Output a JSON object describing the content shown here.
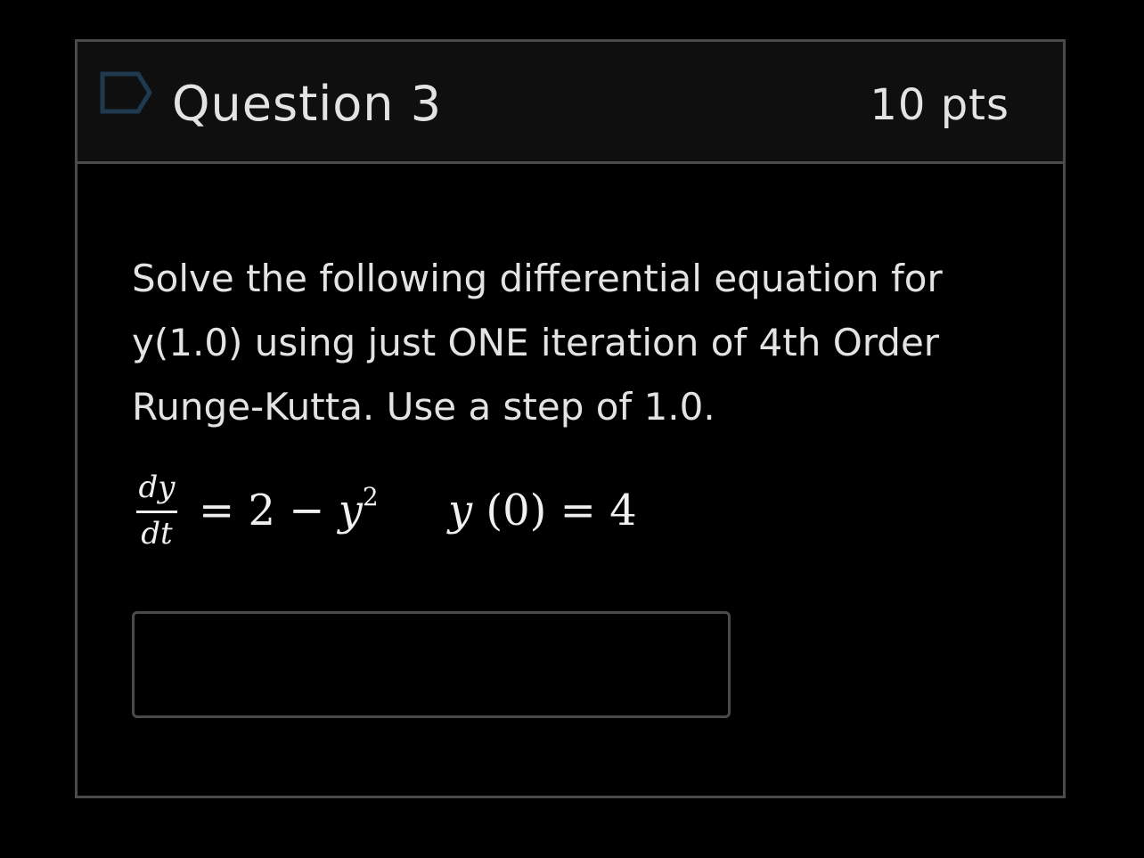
{
  "question": {
    "title": "Question 3",
    "points": "10 pts",
    "flag_icon": "flag-outline-icon",
    "text": "Solve the following differential equation for y(1.0) using just ONE iteration of 4th Order Runge-Kutta. Use a step of 1.0.",
    "equation": {
      "derivative_numerator": "dy",
      "derivative_denominator": "dt",
      "rhs_prefix": "= 2 − ",
      "rhs_var": "y",
      "rhs_exponent": "2",
      "initial_var": "y",
      "initial_arg": " (0) = 4"
    },
    "answer": {
      "value": "",
      "placeholder": ""
    }
  },
  "colors": {
    "background": "#000000",
    "header_background": "#0f0f0f",
    "border": "#4a4a4a",
    "text": "#e3e3e3",
    "flag_stroke": "#1f3a4f"
  }
}
